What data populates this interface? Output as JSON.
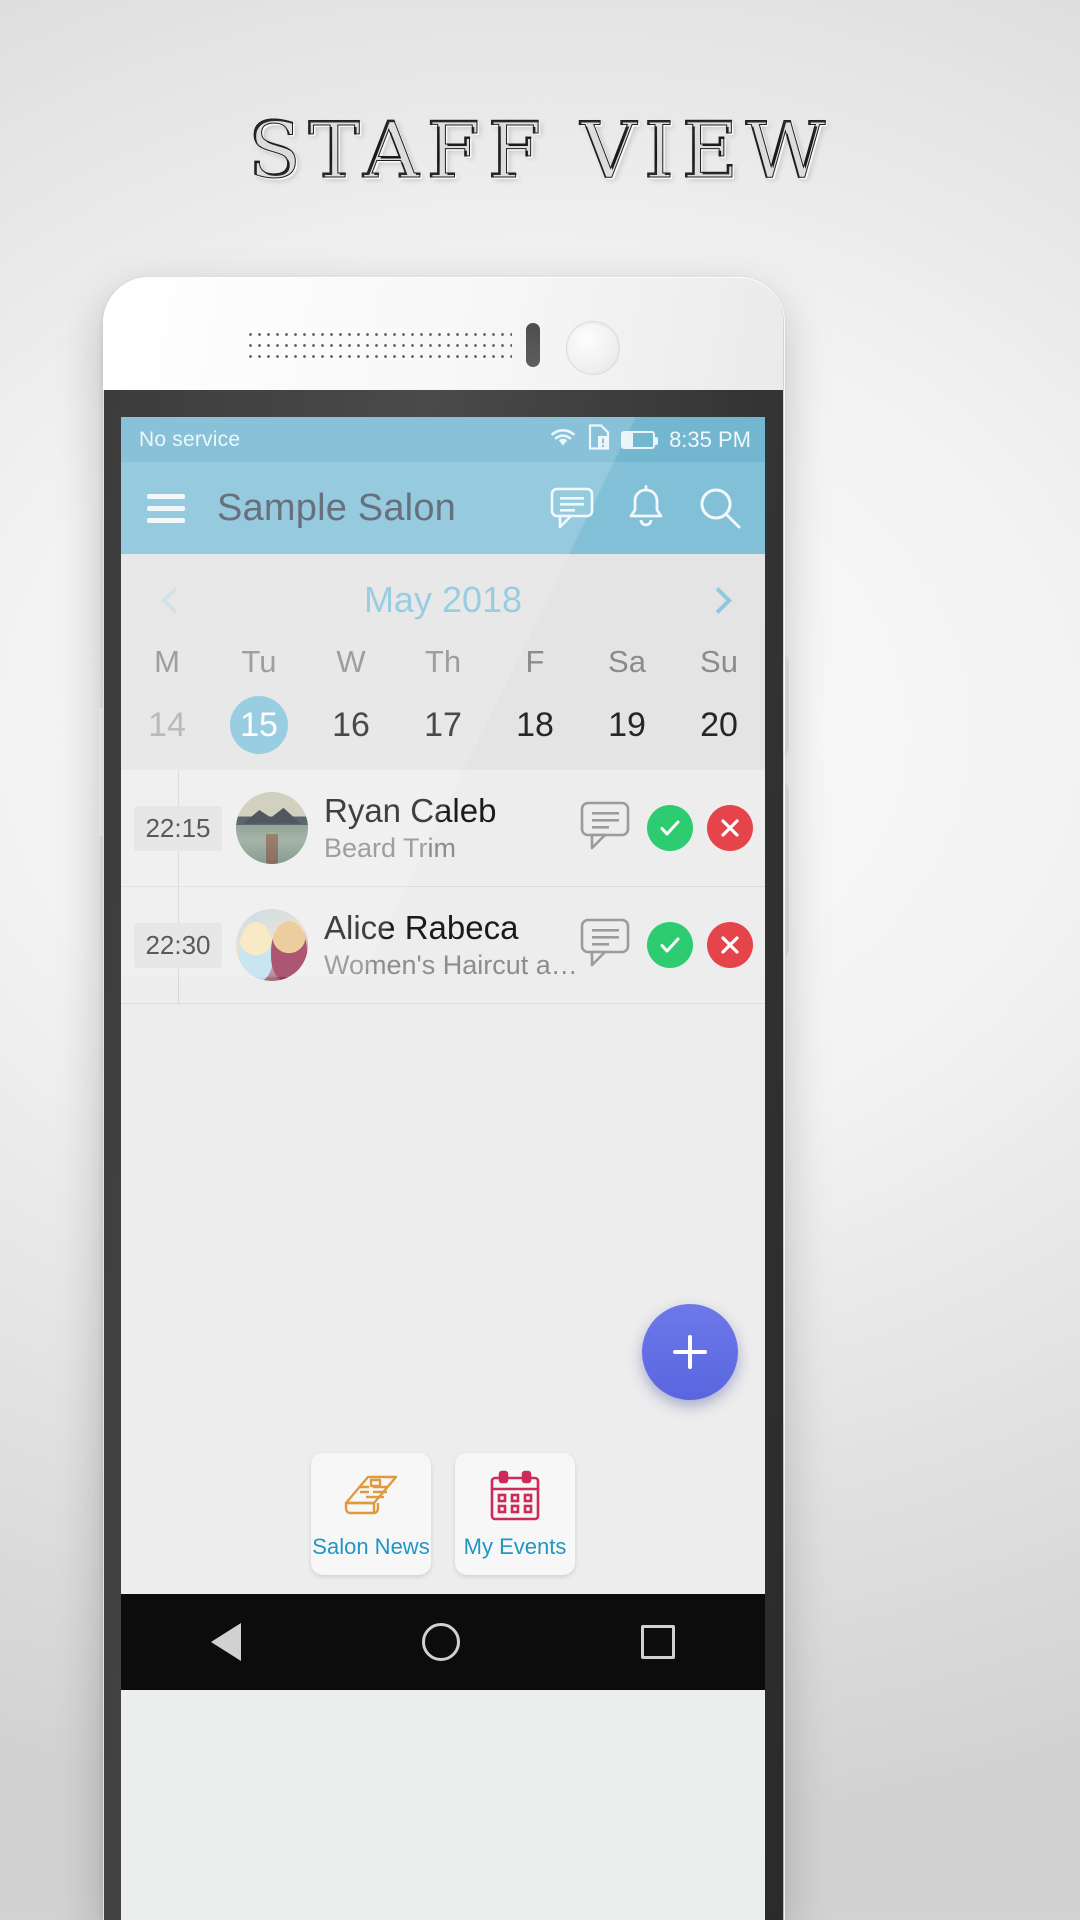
{
  "promo": {
    "title": "STAFF VIEW"
  },
  "statusbar": {
    "carrier": "No service",
    "time": "8:35 PM",
    "icons": [
      "wifi-icon",
      "sim-missing-icon",
      "battery-icon"
    ]
  },
  "appbar": {
    "title": "Sample Salon",
    "menu_icon": "hamburger-menu-icon",
    "actions": [
      "chat-icon",
      "bell-icon",
      "search-icon"
    ]
  },
  "calendar": {
    "month": "May 2018",
    "prev_icon": "chevron-left-icon",
    "next_icon": "chevron-right-icon",
    "weekdays": [
      "M",
      "Tu",
      "W",
      "Th",
      "F",
      "Sa",
      "Su"
    ],
    "days": [
      {
        "num": "14",
        "state": "past"
      },
      {
        "num": "15",
        "state": "selected"
      },
      {
        "num": "16",
        "state": "normal"
      },
      {
        "num": "17",
        "state": "normal"
      },
      {
        "num": "18",
        "state": "normal"
      },
      {
        "num": "19",
        "state": "normal"
      },
      {
        "num": "20",
        "state": "normal"
      }
    ],
    "selected_color": "#86c5dd"
  },
  "appointments": [
    {
      "time": "22:15",
      "name": "Ryan  Caleb",
      "service": "Beard Trim",
      "avatar": "lake-photo-avatar",
      "chat_icon": "chat-icon",
      "accept_icon": "check-icon",
      "decline_icon": "close-icon"
    },
    {
      "time": "22:30",
      "name": "Alice Rabeca",
      "service": "Women's Haircut and Blow...",
      "avatar": "cartoon-sisters-avatar",
      "chat_icon": "chat-icon",
      "accept_icon": "check-icon",
      "decline_icon": "close-icon"
    }
  ],
  "fab": {
    "icon": "plus-icon",
    "color": "#5a66e0"
  },
  "tabs": [
    {
      "label": "Salon News",
      "icon": "newspaper-icon",
      "color": "#e09a3e"
    },
    {
      "label": "My Events",
      "icon": "calendar-icon",
      "color": "#cc2a58"
    }
  ],
  "navbar": {
    "back": "back-triangle-icon",
    "home": "home-circle-icon",
    "recent": "recents-square-icon"
  },
  "colors": {
    "statusbar": "#72b6d0",
    "appbar": "#82c0d8",
    "accent": "#86c5dd",
    "accept": "#2ecc71",
    "decline": "#e5444a"
  }
}
